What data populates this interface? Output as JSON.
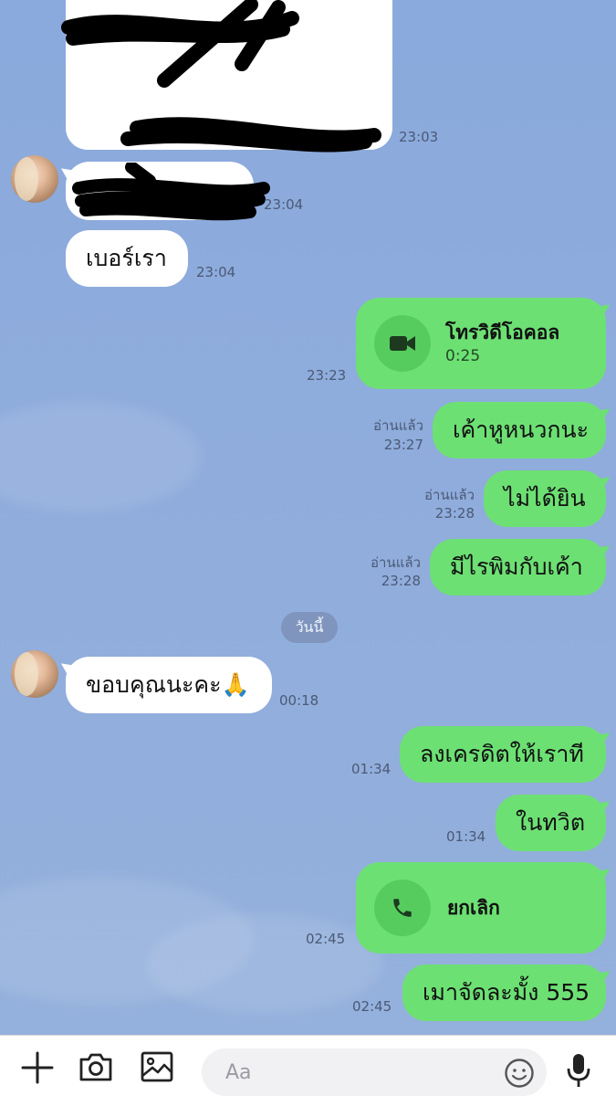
{
  "chat": {
    "messages": [
      {
        "text": "เบอร์เรา",
        "time": "23:04"
      },
      {
        "title": "โทรวิดีโอคอล",
        "duration": "0:25",
        "time": "23:23",
        "icon": "video-camera-icon"
      },
      {
        "text": "เค้าหูหนวกนะ",
        "read": "อ่านแล้ว",
        "time": "23:27"
      },
      {
        "text": "ไม่ได้ยิน",
        "read": "อ่านแล้ว",
        "time": "23:28"
      },
      {
        "text": "มีไรพิมกับเค้า",
        "read": "อ่านแล้ว",
        "time": "23:28"
      },
      {
        "text": "ขอบคุณนะคะ🙏",
        "time": "00:18"
      },
      {
        "text": "ลงเครดิตให้เราที",
        "time": "01:34"
      },
      {
        "text": "ในทวิต",
        "time": "01:34"
      },
      {
        "title": "ยกเลิก",
        "time": "02:45",
        "icon": "phone-icon"
      },
      {
        "text": "เมาจัดละมั้ง 555",
        "time": "02:45"
      }
    ],
    "top_times": [
      "23:03",
      "23:04"
    ],
    "date_divider": "วันนี้"
  },
  "input_bar": {
    "placeholder": "Aa",
    "icons": [
      "plus-icon",
      "camera-icon",
      "image-icon",
      "emoji-icon",
      "microphone-icon"
    ]
  },
  "colors": {
    "background": "#8eacdb",
    "outgoing_bubble": "#6de074",
    "incoming_bubble": "#ffffff",
    "call_icon_circle": "#56cc5f"
  }
}
